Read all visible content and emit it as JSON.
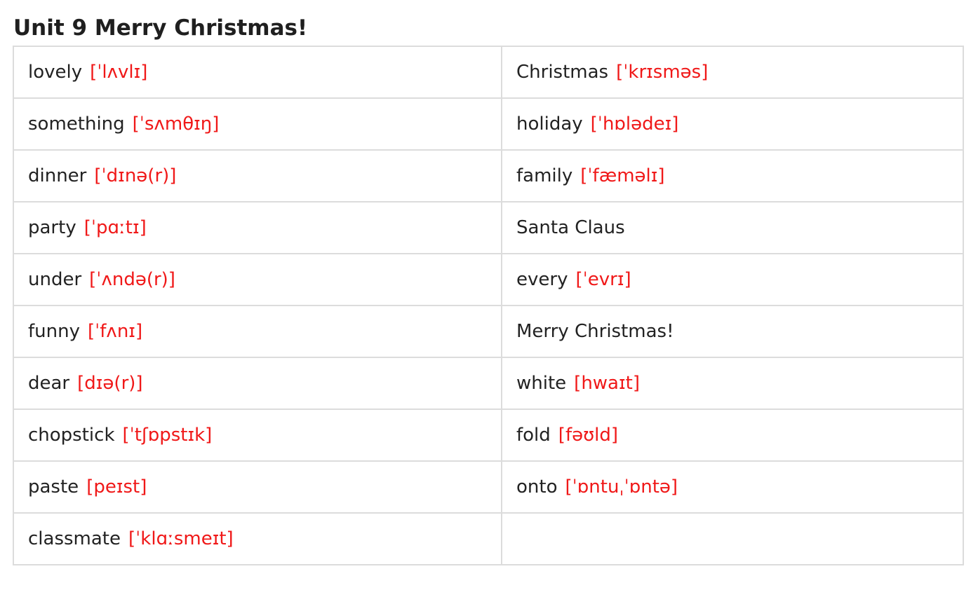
{
  "title": "Unit 9 Merry Christmas!",
  "colors": {
    "word": "#222222",
    "phonetic": "#f01818",
    "border": "#dcdcdc"
  },
  "rows": [
    [
      {
        "word": "lovely",
        "phonetic": "[ˈlʌvlɪ]"
      },
      {
        "word": "Christmas",
        "phonetic": "[ˈkrɪsməs]"
      }
    ],
    [
      {
        "word": "something",
        "phonetic": "[ˈsʌmθɪŋ]"
      },
      {
        "word": "holiday",
        "phonetic": "[ˈhɒlədeɪ]"
      }
    ],
    [
      {
        "word": "dinner",
        "phonetic": "[ˈdɪnə(r)]"
      },
      {
        "word": "family",
        "phonetic": "[ˈfæməlɪ]"
      }
    ],
    [
      {
        "word": "party",
        "phonetic": "[ˈpɑːtɪ]"
      },
      {
        "word": "Santa Claus",
        "phonetic": ""
      }
    ],
    [
      {
        "word": "under",
        "phonetic": "[ˈʌndə(r)]"
      },
      {
        "word": "every",
        "phonetic": "[ˈevrɪ]"
      }
    ],
    [
      {
        "word": "funny",
        "phonetic": "[ˈfʌnɪ]"
      },
      {
        "word": "Merry Christmas!",
        "phonetic": ""
      }
    ],
    [
      {
        "word": "dear",
        "phonetic": "[dɪə(r)]"
      },
      {
        "word": "white",
        "phonetic": "[hwaɪt]"
      }
    ],
    [
      {
        "word": "chopstick",
        "phonetic": "[ˈtʃɒpstɪk]"
      },
      {
        "word": "fold",
        "phonetic": "[fəʊld]"
      }
    ],
    [
      {
        "word": "paste",
        "phonetic": "[peɪst]"
      },
      {
        "word": "onto",
        "phonetic": "[ˈɒntuˌˈɒntə]"
      }
    ],
    [
      {
        "word": "classmate",
        "phonetic": "[ˈklɑːsmeɪt]"
      },
      {
        "word": "",
        "phonetic": ""
      }
    ]
  ]
}
